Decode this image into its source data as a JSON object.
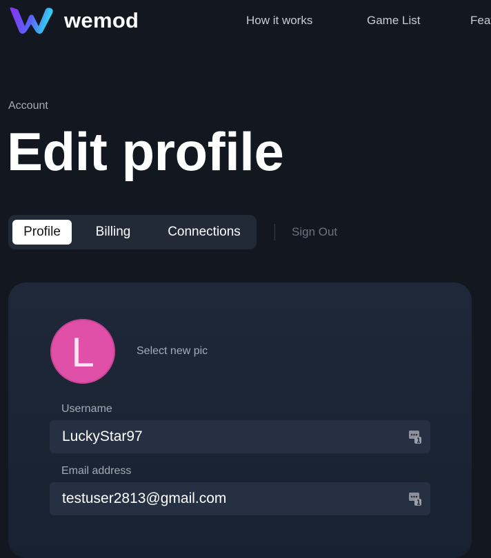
{
  "header": {
    "logo_text": "wemod",
    "nav": [
      {
        "label": "How it works"
      },
      {
        "label": "Game List"
      },
      {
        "label": "Features"
      }
    ]
  },
  "page": {
    "breadcrumb": "Account",
    "title": "Edit profile"
  },
  "tabs": [
    {
      "label": "Profile",
      "active": true
    },
    {
      "label": "Billing",
      "active": false
    },
    {
      "label": "Connections",
      "active": false
    }
  ],
  "sign_out_label": "Sign Out",
  "profile": {
    "avatar_letter": "L",
    "avatar_color": "#e04fa8",
    "select_pic_label": "Select new pic",
    "username": {
      "label": "Username",
      "value": "LuckyStar97",
      "icon": "password-manager-icon"
    },
    "email": {
      "label": "Email address",
      "value": "testuser2813@gmail.com",
      "icon": "password-manager-icon"
    }
  },
  "colors": {
    "background": "#13171f",
    "card": "#1e2838",
    "input": "#253142",
    "logo_gradient": [
      "#7b3ff2",
      "#2fd8f0"
    ]
  }
}
